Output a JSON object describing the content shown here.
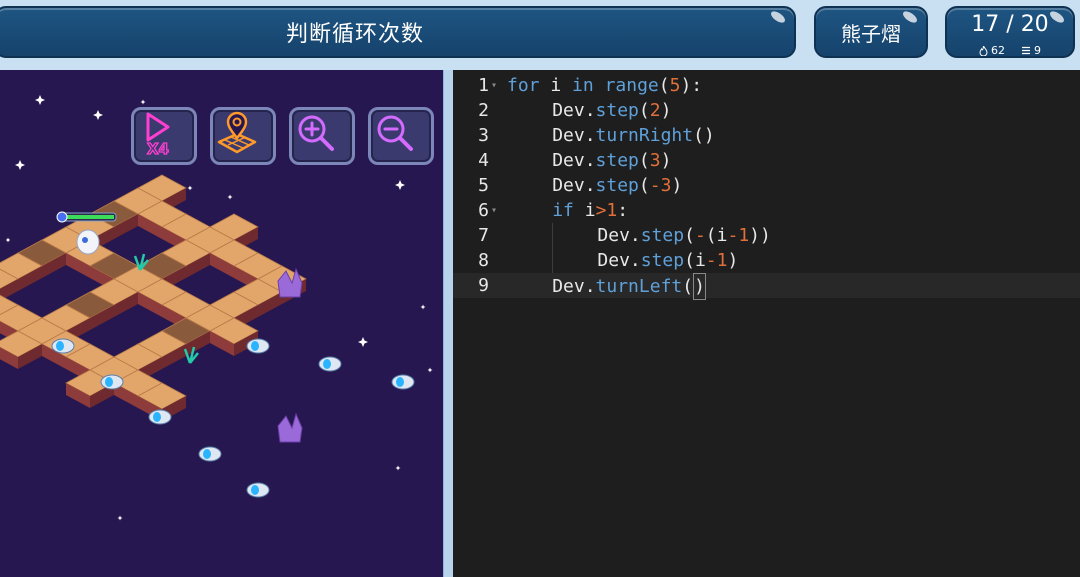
{
  "header": {
    "title": "判断循环次数",
    "user": "熊子熠",
    "level": "17 / 20",
    "energy": "62",
    "lines": "9"
  },
  "toolbar": {
    "speed_label": "X4"
  },
  "colors": {
    "header_bg": "#1a4c78",
    "game_bg": "#261750",
    "editor_bg": "#1e1e1e",
    "keyword": "#5fa0d8",
    "number": "#e0703a"
  },
  "editor": {
    "lines": [
      {
        "n": "1",
        "fold": true,
        "indent": 0,
        "tokens": [
          [
            "kw",
            "for"
          ],
          [
            "t",
            " i "
          ],
          [
            "kw",
            "in"
          ],
          [
            "t",
            " "
          ],
          [
            "fn",
            "range"
          ],
          [
            "t",
            "("
          ],
          [
            "num",
            "5"
          ],
          [
            "t",
            "):"
          ]
        ]
      },
      {
        "n": "2",
        "fold": false,
        "indent": 1,
        "tokens": [
          [
            "t",
            "Dev."
          ],
          [
            "fn",
            "step"
          ],
          [
            "t",
            "("
          ],
          [
            "num",
            "2"
          ],
          [
            "t",
            ")"
          ]
        ]
      },
      {
        "n": "3",
        "fold": false,
        "indent": 1,
        "tokens": [
          [
            "t",
            "Dev."
          ],
          [
            "fn",
            "turnRight"
          ],
          [
            "t",
            "()"
          ]
        ]
      },
      {
        "n": "4",
        "fold": false,
        "indent": 1,
        "tokens": [
          [
            "t",
            "Dev."
          ],
          [
            "fn",
            "step"
          ],
          [
            "t",
            "("
          ],
          [
            "num",
            "3"
          ],
          [
            "t",
            ")"
          ]
        ]
      },
      {
        "n": "5",
        "fold": false,
        "indent": 1,
        "tokens": [
          [
            "t",
            "Dev."
          ],
          [
            "fn",
            "step"
          ],
          [
            "t",
            "("
          ],
          [
            "num",
            "-3"
          ],
          [
            "t",
            ")"
          ]
        ]
      },
      {
        "n": "6",
        "fold": true,
        "indent": 1,
        "tokens": [
          [
            "kw",
            "if"
          ],
          [
            "t",
            " i"
          ],
          [
            "op",
            ">"
          ],
          [
            "num",
            "1"
          ],
          [
            "t",
            ":"
          ]
        ]
      },
      {
        "n": "7",
        "fold": false,
        "indent": 2,
        "tokens": [
          [
            "t",
            "Dev."
          ],
          [
            "fn",
            "step"
          ],
          [
            "t",
            "("
          ],
          [
            "op",
            "-"
          ],
          [
            "t",
            "(i"
          ],
          [
            "op",
            "-"
          ],
          [
            "num",
            "1"
          ],
          [
            "t",
            "))"
          ]
        ]
      },
      {
        "n": "8",
        "fold": false,
        "indent": 2,
        "tokens": [
          [
            "t",
            "Dev."
          ],
          [
            "fn",
            "step"
          ],
          [
            "t",
            "(i"
          ],
          [
            "op",
            "-"
          ],
          [
            "num",
            "1"
          ],
          [
            "t",
            ")"
          ]
        ]
      },
      {
        "n": "9",
        "fold": false,
        "indent": 1,
        "active": true,
        "tokens": [
          [
            "t",
            "Dev."
          ],
          [
            "fn",
            "turnLeft"
          ],
          [
            "t",
            "("
          ],
          [
            "cur",
            ")"
          ]
        ]
      }
    ]
  }
}
